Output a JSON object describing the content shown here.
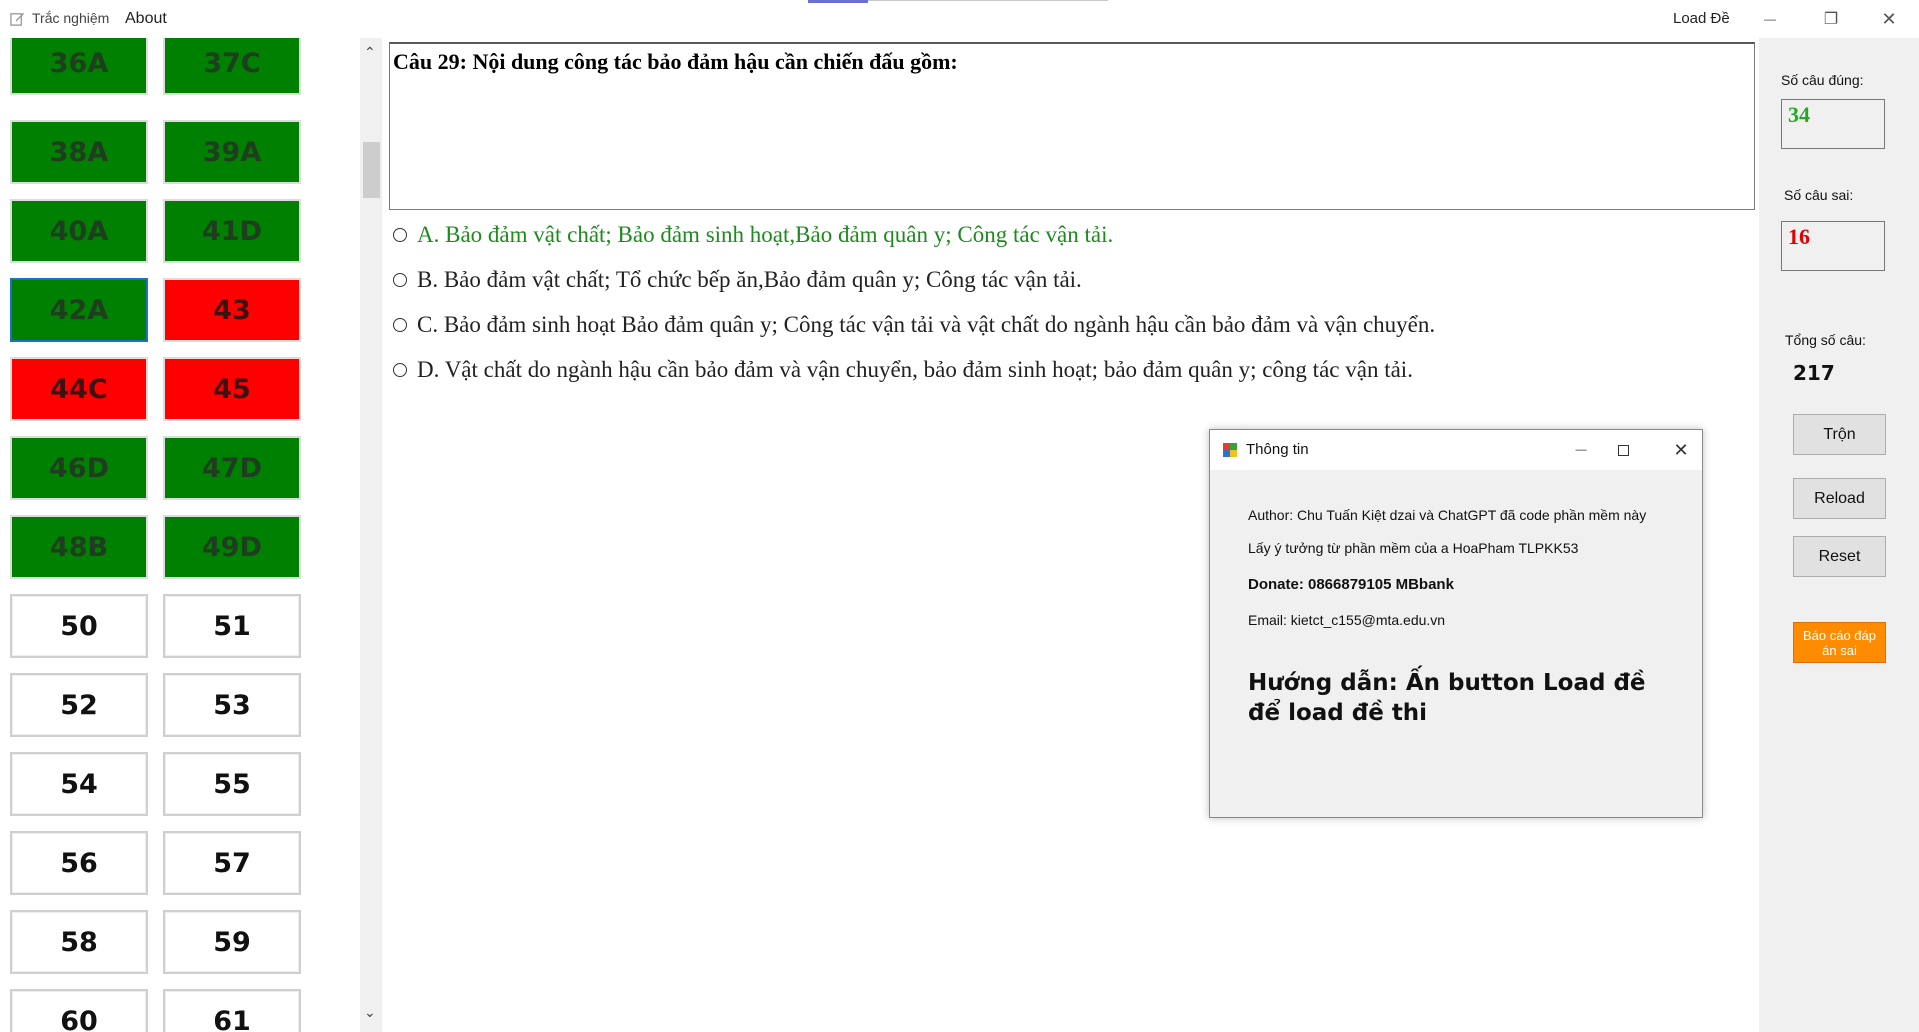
{
  "menu": {
    "quiz_label": "Trắc nghiệm",
    "about_label": "About",
    "load_label": "Load Đề"
  },
  "window_controls": {
    "minimize": "—",
    "restore": "❐",
    "close": "✕"
  },
  "grid": {
    "cells": [
      {
        "label": "36A",
        "state": "green"
      },
      {
        "label": "37C",
        "state": "green"
      },
      {
        "label": "38A",
        "state": "green"
      },
      {
        "label": "39A",
        "state": "green"
      },
      {
        "label": "40A",
        "state": "green"
      },
      {
        "label": "41D",
        "state": "green"
      },
      {
        "label": "42A",
        "state": "green",
        "selected": true
      },
      {
        "label": "43",
        "state": "red"
      },
      {
        "label": "44C",
        "state": "red"
      },
      {
        "label": "45",
        "state": "red"
      },
      {
        "label": "46D",
        "state": "green"
      },
      {
        "label": "47D",
        "state": "green"
      },
      {
        "label": "48B",
        "state": "green"
      },
      {
        "label": "49D",
        "state": "green"
      },
      {
        "label": "50",
        "state": "blank"
      },
      {
        "label": "51",
        "state": "blank"
      },
      {
        "label": "52",
        "state": "blank"
      },
      {
        "label": "53",
        "state": "blank"
      },
      {
        "label": "54",
        "state": "blank"
      },
      {
        "label": "55",
        "state": "blank"
      },
      {
        "label": "56",
        "state": "blank"
      },
      {
        "label": "57",
        "state": "blank"
      },
      {
        "label": "58",
        "state": "blank"
      },
      {
        "label": "59",
        "state": "blank"
      },
      {
        "label": "60",
        "state": "blank"
      },
      {
        "label": "61",
        "state": "blank"
      }
    ]
  },
  "question": {
    "text": "Câu 29: Nội dung công tác bảo đảm hậu cần chiến đấu gồm:",
    "options": [
      {
        "text": "A. Bảo đảm vật chất; Bảo đảm sinh hoạt,Bảo đảm quân y; Công tác vận tải.",
        "correct": true
      },
      {
        "text": "B. Bảo đảm vật chất; Tổ chức bếp ăn,Bảo đảm quân y; Công tác vận tải.",
        "correct": false
      },
      {
        "text": "C. Bảo đảm sinh hoạt Bảo đảm quân y; Công tác vận tải và vật chất do ngành hậu cần bảo đảm và vận chuyển.",
        "correct": false
      },
      {
        "text": "D. Vật chất do ngành hậu cần bảo đảm và vận chuyển, bảo đảm sinh hoạt; bảo đảm quân y; công tác vận tải.",
        "correct": false
      }
    ]
  },
  "stats": {
    "correct_label": "Số câu đúng:",
    "correct_value": "34",
    "wrong_label": "Số câu sai:",
    "wrong_value": "16",
    "total_label": "Tổng số câu:",
    "total_value": "217"
  },
  "buttons": {
    "shuffle": "Trộn",
    "reload": "Reload",
    "reset": "Reset",
    "report": "Báo cáo đáp án sai"
  },
  "dialog": {
    "title": "Thông tin",
    "author": "Author: Chu Tuấn Kiệt dzai và ChatGPT đã code phần mềm này",
    "idea": "Lấy ý tưởng từ phần mềm của a HoaPham TLPKK53",
    "donate": "Donate: 0866879105 MBbank",
    "email": "Email: kietct_c155@mta.edu.vn",
    "guide": "Hướng dẫn: Ấn button Load đề để load đề thi"
  },
  "colors": {
    "correct_green": "#008000",
    "wrong_red": "#ff0000",
    "correct_count": "#22aa22",
    "wrong_count": "#e00000",
    "report_orange": "#ff8c00"
  }
}
